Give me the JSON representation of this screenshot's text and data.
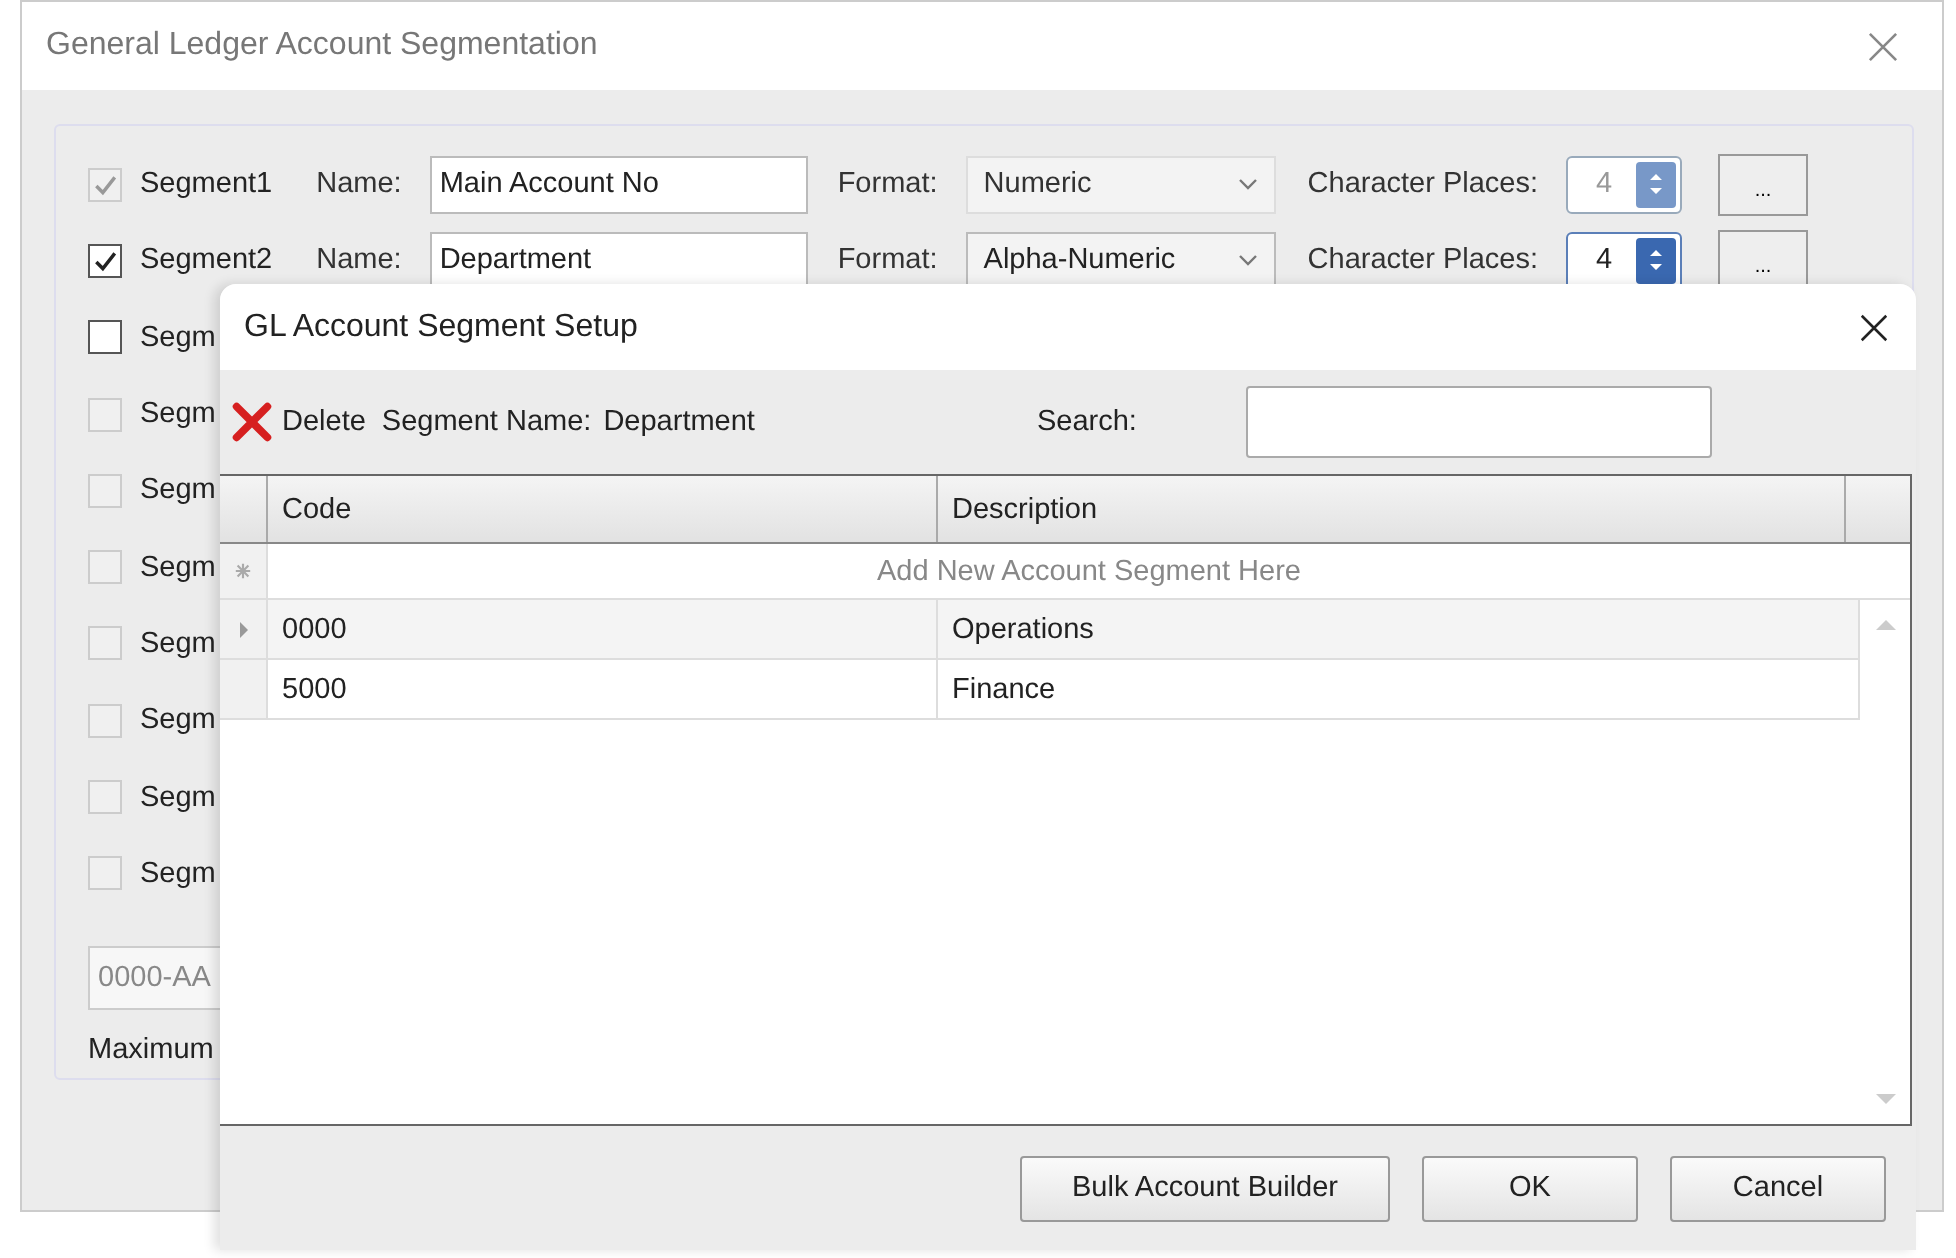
{
  "window": {
    "title": "General Ledger Account Segmentation"
  },
  "segments": [
    {
      "label": "Segment1",
      "checked": true,
      "disabled": true,
      "name_label": "Name:",
      "name": "Main Account No",
      "format_label": "Format:",
      "format": "Numeric",
      "places_label": "Character Places:",
      "places": "4",
      "more": "..."
    },
    {
      "label": "Segment2",
      "checked": true,
      "disabled": false,
      "name_label": "Name:",
      "name": "Department",
      "format_label": "Format:",
      "format": "Alpha-Numeric",
      "places_label": "Character Places:",
      "places": "4",
      "more": "..."
    },
    {
      "label": "Segm",
      "checked": false,
      "disabled": false
    },
    {
      "label": "Segm",
      "checked": false,
      "disabled": true
    },
    {
      "label": "Segm",
      "checked": false,
      "disabled": true
    },
    {
      "label": "Segm",
      "checked": false,
      "disabled": true
    },
    {
      "label": "Segm",
      "checked": false,
      "disabled": true
    },
    {
      "label": "Segm",
      "checked": false,
      "disabled": true
    },
    {
      "label": "Segm",
      "checked": false,
      "disabled": true
    },
    {
      "label": "Segm",
      "checked": false,
      "disabled": true
    }
  ],
  "preview": "0000-AA",
  "maximum_label": "Maximum",
  "dialog": {
    "title": "GL Account Segment Setup",
    "delete": "Delete",
    "segment_name_label": "Segment Name:",
    "segment_name": "Department",
    "search_label": "Search:",
    "columns": [
      "Code",
      "Description"
    ],
    "new_row": "Add New Account Segment Here",
    "rows": [
      {
        "code": "0000",
        "description": "Operations",
        "selected": true
      },
      {
        "code": "5000",
        "description": "Finance",
        "selected": false
      }
    ],
    "buttons": [
      "Bulk Account Builder",
      "OK",
      "Cancel"
    ]
  }
}
